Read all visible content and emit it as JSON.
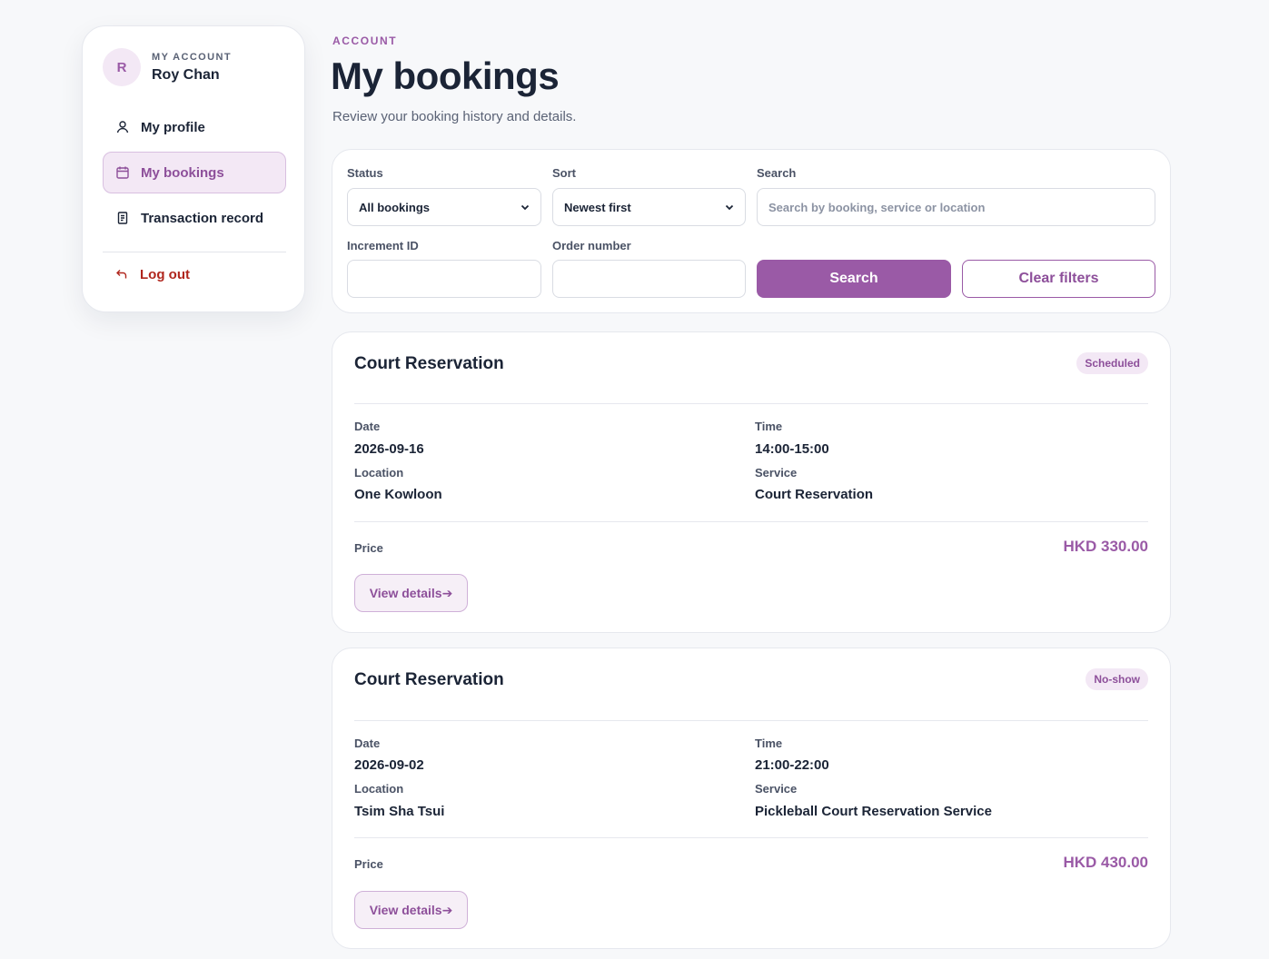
{
  "colors": {
    "accent": "#9a5aa6",
    "danger": "#b0261d",
    "text": "#1b2436",
    "muted": "#5a6275",
    "background": "#f7f8fa"
  },
  "sidebar": {
    "avatar_initial": "R",
    "kicker": "MY ACCOUNT",
    "user_name": "Roy Chan",
    "items": [
      {
        "label": "My profile",
        "icon": "user-icon",
        "active": false
      },
      {
        "label": "My bookings",
        "icon": "calendar-icon",
        "active": true
      },
      {
        "label": "Transaction record",
        "icon": "receipt-icon",
        "active": false
      }
    ],
    "logout_label": "Log out"
  },
  "header": {
    "kicker": "ACCOUNT",
    "title": "My bookings",
    "subtitle": "Review your booking history and details."
  },
  "filters": {
    "status_label": "Status",
    "status_value": "All bookings",
    "sort_label": "Sort",
    "sort_value": "Newest first",
    "search_label": "Search",
    "search_placeholder": "Search by booking, service or location",
    "increment_label": "Increment ID",
    "increment_value": "",
    "order_label": "Order number",
    "order_value": "",
    "search_button": "Search",
    "clear_button": "Clear filters"
  },
  "bookings": [
    {
      "title": "Court Reservation",
      "status": "Scheduled",
      "date_label": "Date",
      "date": "2026-09-16",
      "time_label": "Time",
      "time": "14:00-15:00",
      "location_label": "Location",
      "location": "One Kowloon",
      "service_label": "Service",
      "service": "Court Reservation",
      "price_label": "Price",
      "price": "HKD 330.00",
      "details_label": "View details➔"
    },
    {
      "title": "Court Reservation",
      "status": "No-show",
      "date_label": "Date",
      "date": "2026-09-02",
      "time_label": "Time",
      "time": "21:00-22:00",
      "location_label": "Location",
      "location": "Tsim Sha Tsui",
      "service_label": "Service",
      "service": "Pickleball Court Reservation Service",
      "price_label": "Price",
      "price": "HKD 430.00",
      "details_label": "View details➔"
    }
  ]
}
